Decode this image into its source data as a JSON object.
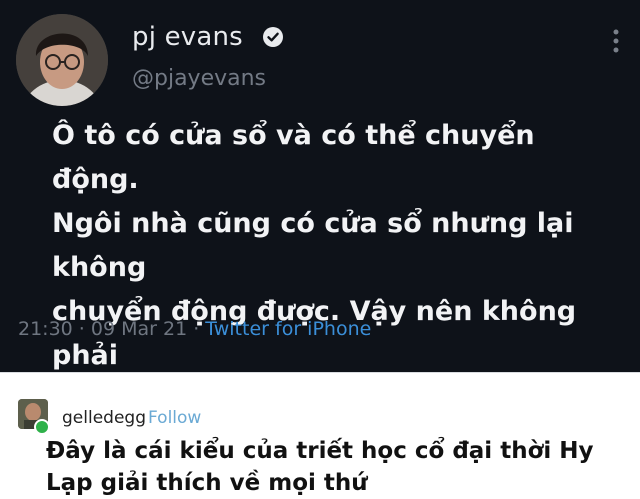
{
  "tweet": {
    "display_name": "pj evans",
    "handle": "@pjayevans",
    "body": "Ô tô có cửa sổ và có thể chuyển động.\nNgôi nhà cũng có cửa sổ nhưng lại không\nchuyển động được. Vậy nên không phải\nnhờ cửa sổ mà ô tô chuyển động, nó phải\nlà nhờ một cái gì đó khác bên trong.",
    "time": "21:30 · 09 Mar 21 · ",
    "source": "Twitter for iPhone",
    "icons": {
      "verified": "verified-badge-icon",
      "more": "more-vertical-icon"
    }
  },
  "reply": {
    "username": "gelledegg",
    "follow_label": "Follow",
    "body": "Đây là cái kiểu của triết học cổ đại thời Hy\nLạp giải thích về mọi thứ"
  },
  "colors": {
    "tweet_bg": "#0e1219",
    "tweet_text": "#f2f3f5",
    "muted": "#6f7681",
    "link": "#3b8fd9",
    "follow": "#6aa9d4",
    "online_badge": "#2fb14a"
  }
}
